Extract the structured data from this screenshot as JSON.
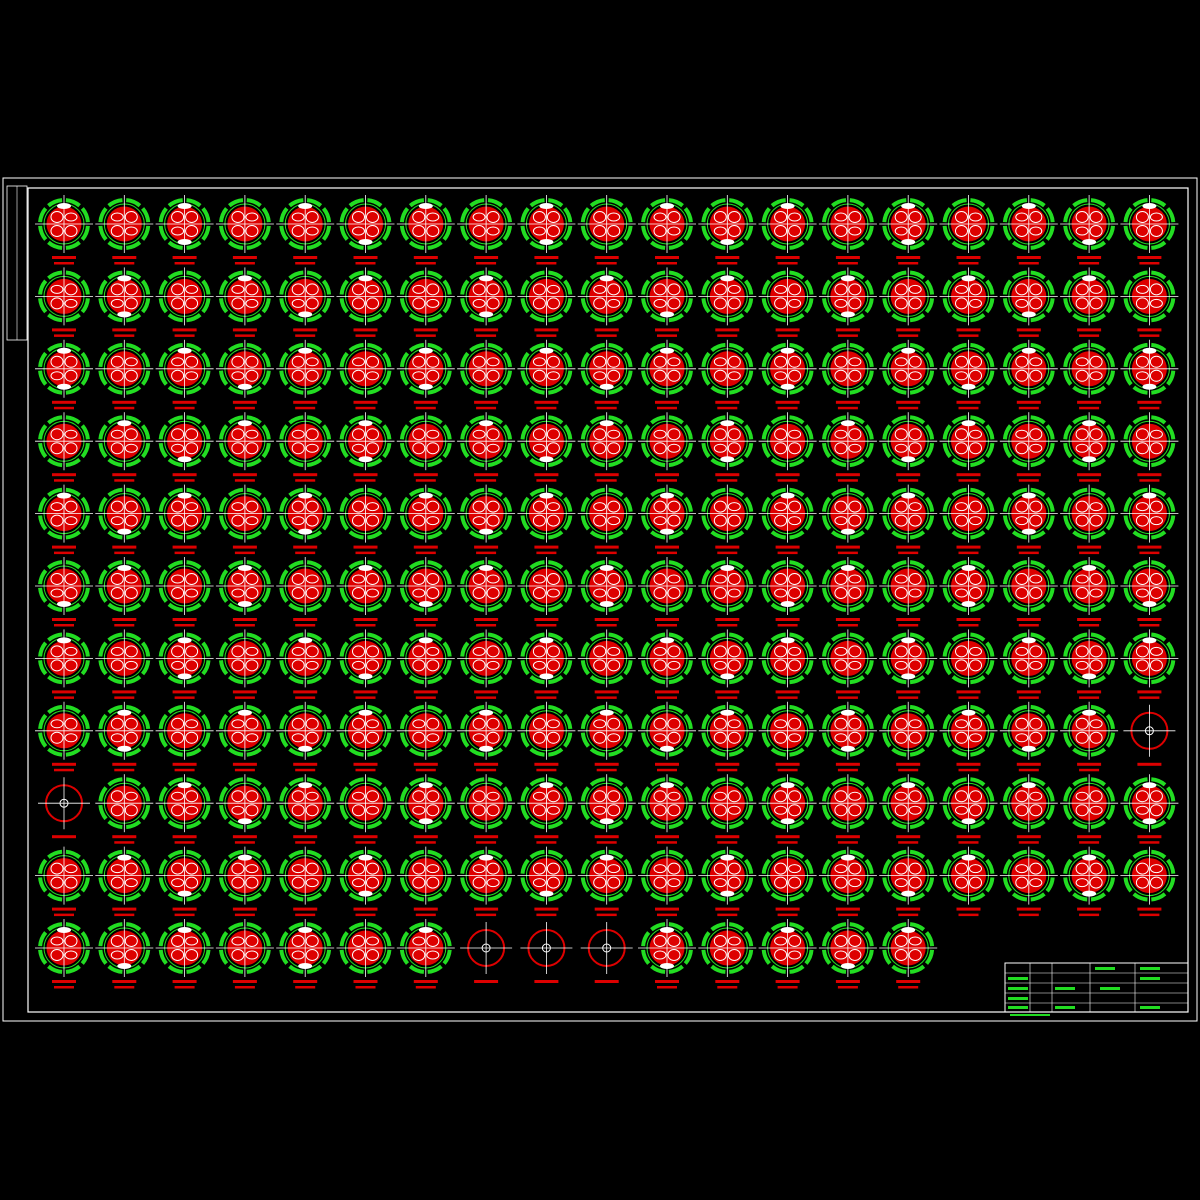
{
  "drawing": {
    "background_color": "#000000",
    "border_color": "#ffffff",
    "rows": 11,
    "columns": 19,
    "symbol_count": 205,
    "special_symbols": [
      {
        "row": 8,
        "column": 19
      },
      {
        "row": 9,
        "column": 1
      },
      {
        "row": 11,
        "column": 8
      },
      {
        "row": 11,
        "column": 9
      },
      {
        "row": 11,
        "column": 10
      }
    ],
    "last_row_symbol_count": 15,
    "colors": {
      "symbol_ring": "#22dd22",
      "symbol_fill": "#dd0000",
      "symbol_detail": "#ffffff",
      "label": "#dd0000",
      "title_block_lines": "#ffffff",
      "title_block_cells": "#22dd22"
    }
  },
  "title_block": {}
}
